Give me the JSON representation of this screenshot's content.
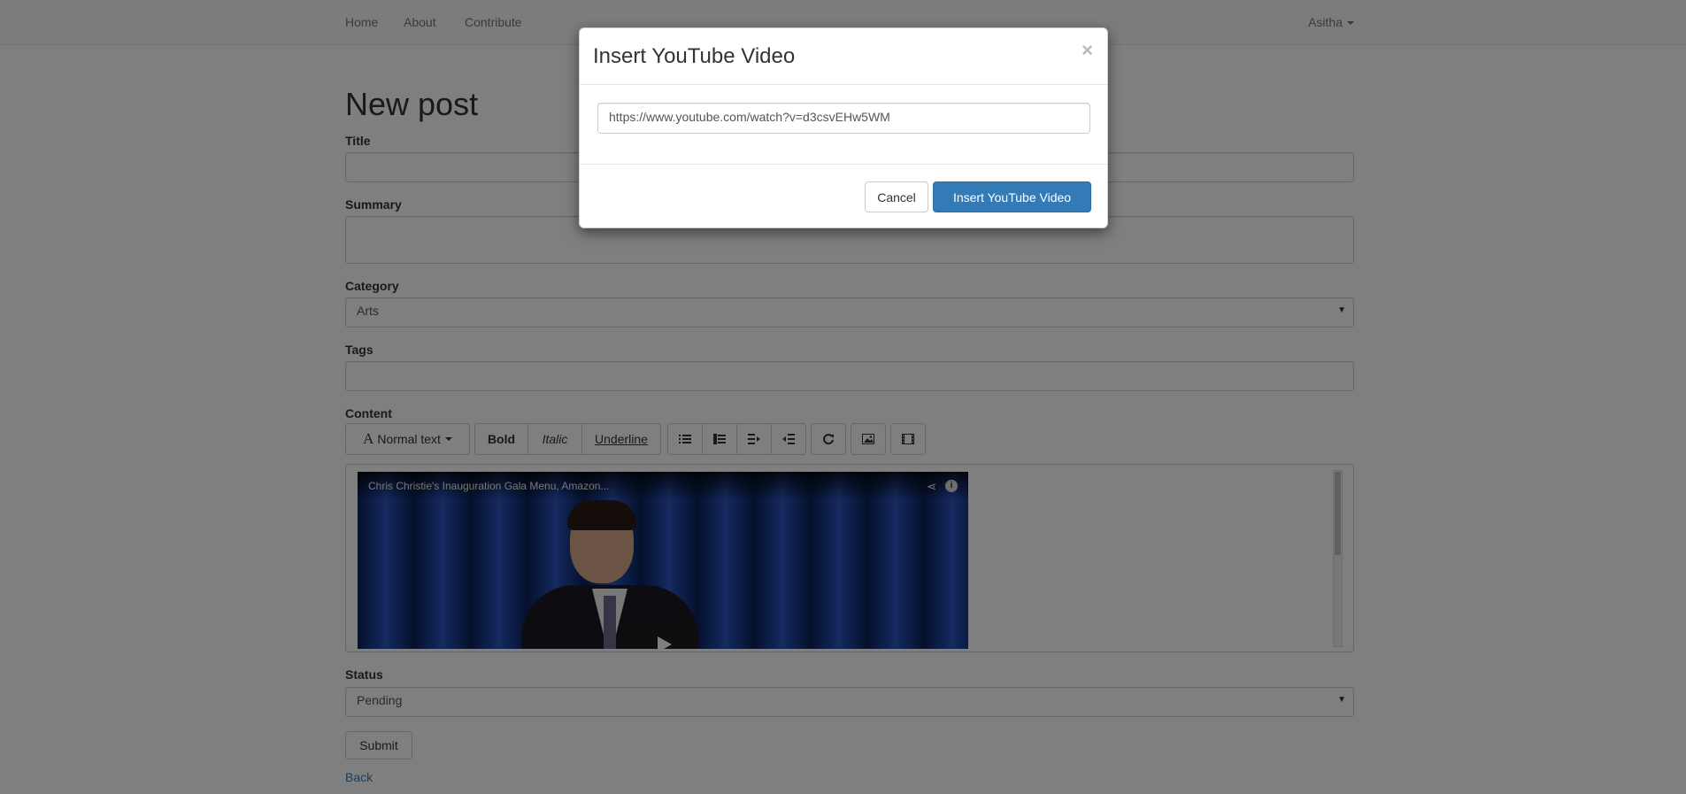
{
  "nav": {
    "home": "Home",
    "about": "About",
    "contribute": "Contribute",
    "user": "Asitha"
  },
  "page": {
    "title": "New post"
  },
  "form": {
    "title_label": "Title",
    "title_value": "",
    "summary_label": "Summary",
    "summary_value": "",
    "category_label": "Category",
    "category_value": "Arts",
    "tags_label": "Tags",
    "tags_value": "",
    "content_label": "Content",
    "status_label": "Status",
    "status_value": "Pending",
    "submit_label": "Submit",
    "back_label": "Back"
  },
  "toolbar": {
    "text_style": "Normal text",
    "bold": "Bold",
    "italic": "Italic",
    "underline": "Underline",
    "icons": [
      "unordered-list-icon",
      "ordered-list-icon",
      "outdent-icon",
      "indent-icon",
      "link-icon",
      "image-icon",
      "video-icon"
    ]
  },
  "editor": {
    "video_title": "Chris Christie's Inauguration Gala Menu, Amazon..."
  },
  "modal": {
    "title": "Insert YouTube Video",
    "close": "×",
    "url_value": "https://www.youtube.com/watch?v=d3csvEHw5WM",
    "cancel_label": "Cancel",
    "insert_label": "Insert YouTube Video"
  },
  "colors": {
    "primary": "#337ab7",
    "backdrop": "rgba(0,0,0,0.5)"
  }
}
